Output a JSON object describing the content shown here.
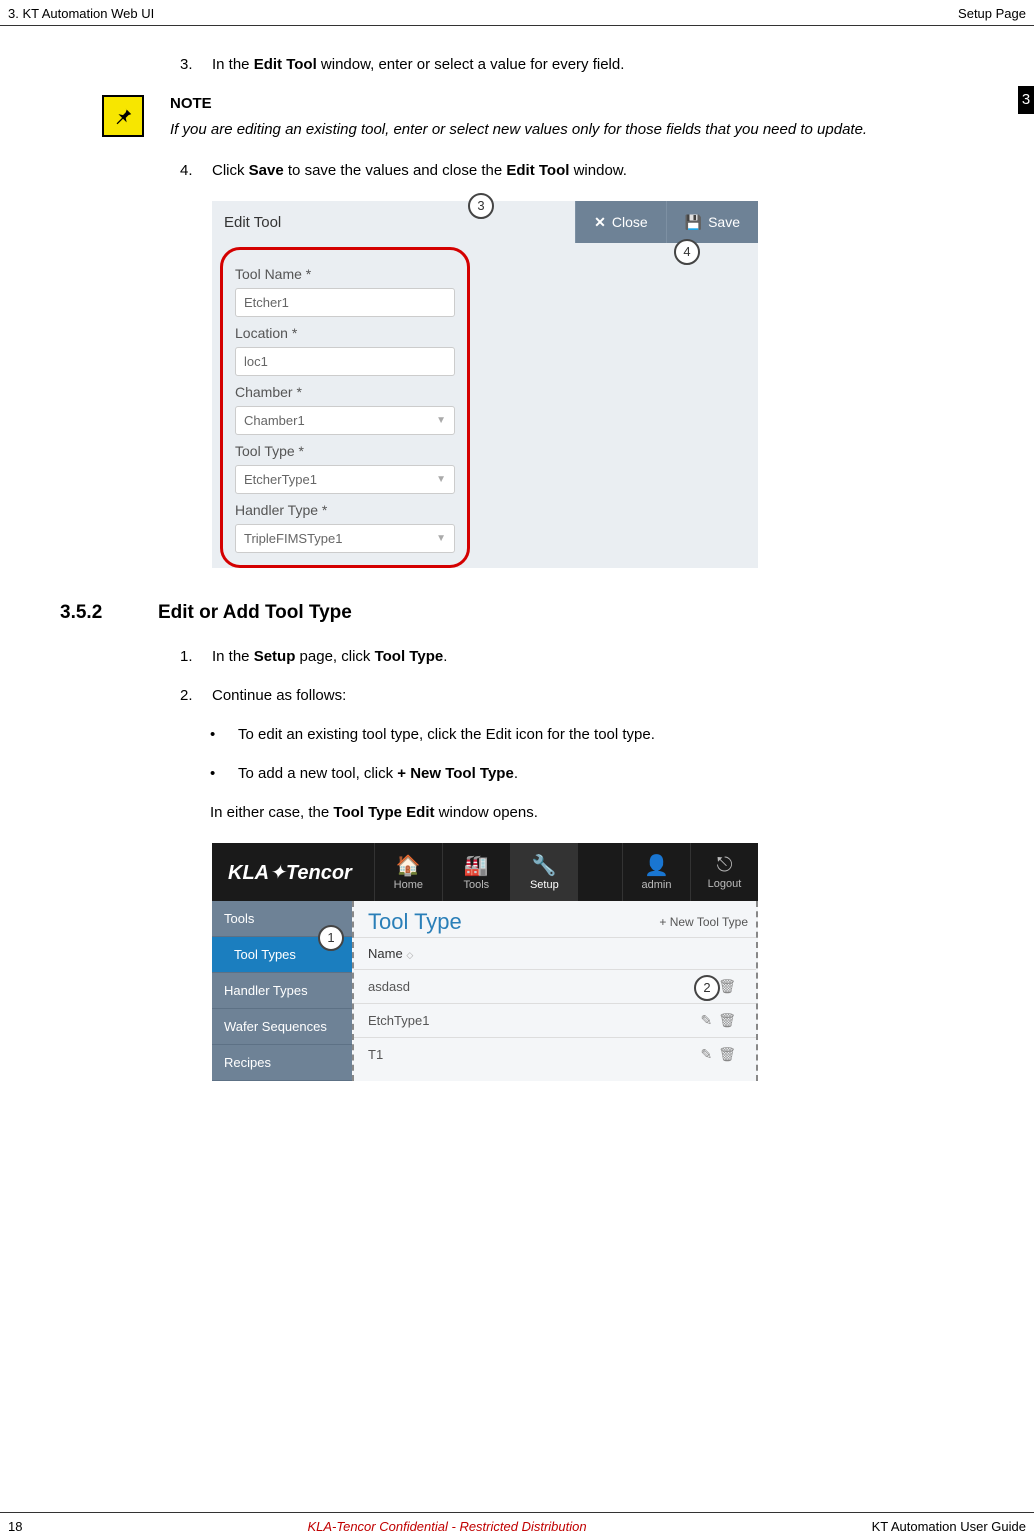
{
  "header": {
    "left": "3. KT Automation Web UI",
    "right": "Setup Page"
  },
  "chapterTab": "3",
  "step3": {
    "num": "3.",
    "pre": "In the ",
    "bold": "Edit Tool",
    "post": " window, enter or select a value for every field."
  },
  "note": {
    "title": "NOTE",
    "text": "If you are editing an existing tool, enter or select new values only for those fields that you need to update."
  },
  "step4": {
    "num": "4.",
    "pre": "Click ",
    "bold1": "Save",
    "mid": " to save the values and close the ",
    "bold2": "Edit Tool",
    "post": " window."
  },
  "fig1": {
    "title": "Edit Tool",
    "closeLabel": "Close",
    "saveLabel": "Save",
    "callout3": "3",
    "callout4": "4",
    "fields": {
      "toolName": {
        "label": "Tool Name *",
        "value": "Etcher1"
      },
      "location": {
        "label": "Location *",
        "value": "loc1"
      },
      "chamber": {
        "label": "Chamber *",
        "value": "Chamber1"
      },
      "toolType": {
        "label": "Tool Type *",
        "value": "EtcherType1"
      },
      "handlerType": {
        "label": "Handler Type *",
        "value": "TripleFIMSType1"
      }
    }
  },
  "section": {
    "num": "3.5.2",
    "title": "Edit or Add Tool Type"
  },
  "s1": {
    "num": "1.",
    "pre": "In the ",
    "bold1": "Setup",
    "mid": " page, click ",
    "bold2": "Tool Type",
    "post": "."
  },
  "s2": {
    "num": "2.",
    "text": "Continue as follows:"
  },
  "bullet1": "To edit an existing tool type, click the Edit icon for the tool type.",
  "bullet2": {
    "pre": "To add a new tool, click ",
    "bold": "+ New Tool Type",
    "post": "."
  },
  "result": {
    "pre": "In either case, the ",
    "bold": "Tool Type Edit",
    "post": " window opens."
  },
  "fig2": {
    "logo1": "KLA",
    "logo2": "Tencor",
    "tabs": {
      "home": "Home",
      "tools": "Tools",
      "setup": "Setup",
      "admin": "admin",
      "logout": "Logout"
    },
    "sidebar": [
      "Tools",
      "Tool Types",
      "Handler Types",
      "Wafer Sequences",
      "Recipes"
    ],
    "mainTitle": "Tool Type",
    "newBtn": "+ New Tool Type",
    "nameHeader": "Name",
    "rows": [
      "asdasd",
      "EtchType1",
      "T1"
    ],
    "callout1": "1",
    "callout2": "2"
  },
  "footer": {
    "pageNum": "18",
    "center": "KLA-Tencor Confidential - Restricted Distribution",
    "right": "KT Automation User Guide"
  }
}
